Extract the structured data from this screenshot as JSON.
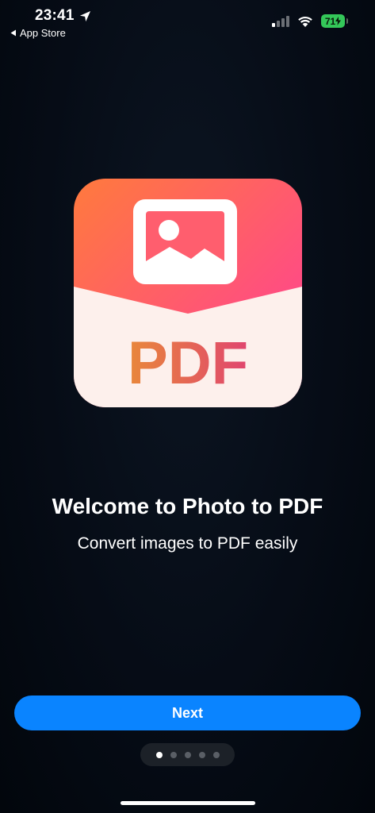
{
  "status_bar": {
    "time": "23:41",
    "back_app": "App Store",
    "battery_level": "71",
    "icons": [
      "location-arrow-icon",
      "cellular-signal-icon",
      "wifi-icon",
      "battery-charging-icon"
    ]
  },
  "logo": {
    "label": "PDF",
    "icon": "photo-to-pdf-logo",
    "colors": {
      "gradient_start": "#ff7a3d",
      "gradient_end": "#ff3c9c",
      "paper": "#fdf0ec",
      "text_start": "#e9883a",
      "text_end": "#e0456f"
    }
  },
  "onboarding": {
    "title": "Welcome to Photo to PDF",
    "subtitle": "Convert images to PDF easily"
  },
  "next_button": {
    "label": "Next",
    "color": "#0a84ff"
  },
  "page_indicator": {
    "total": 5,
    "current": 1
  }
}
